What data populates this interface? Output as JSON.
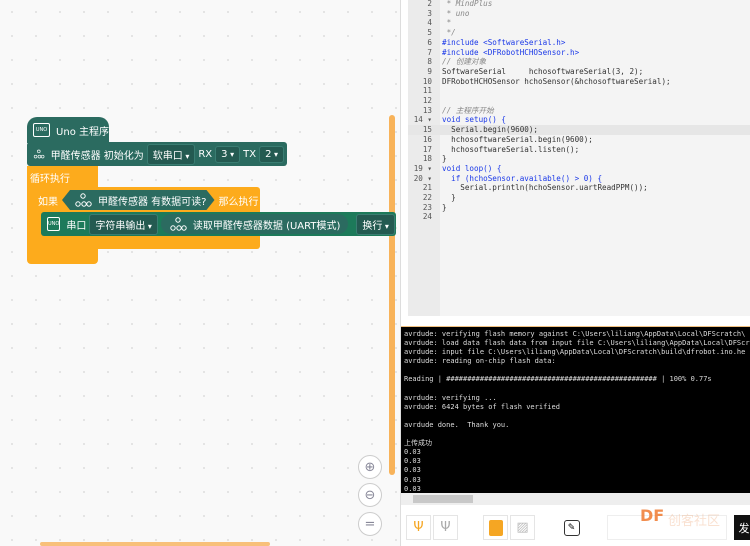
{
  "blocks": {
    "main_hat": "Uno 主程序",
    "uno_badge": "UNO",
    "init": {
      "label": "甲醛传感器 初始化为",
      "port": "软串口",
      "rx_label": "RX",
      "rx": "3",
      "tx_label": "TX",
      "tx": "2"
    },
    "loop": "循环执行",
    "if": {
      "label": "如果",
      "condition": "甲醛传感器 有数据可读?",
      "then": "那么执行"
    },
    "serial": {
      "label": "串口",
      "mode": "字符串输出",
      "reporter": "读取甲醛传感器数据 (UART模式)",
      "newline": "换行"
    }
  },
  "zoom_controls": {
    "zoom_in": "⊕",
    "zoom_out": "⊖",
    "reset": "="
  },
  "code": [
    {
      "n": "2",
      "t": " * MindPlus",
      "c": "cm"
    },
    {
      "n": "3",
      "t": " * uno",
      "c": "cm"
    },
    {
      "n": "4",
      "t": " *",
      "c": "cm"
    },
    {
      "n": "5",
      "t": " */",
      "c": "cm"
    },
    {
      "n": "6",
      "t": "#include <SoftwareSerial.h>",
      "c": "kw"
    },
    {
      "n": "7",
      "t": "#include <DFRobotHCHOSensor.h>",
      "c": "kw"
    },
    {
      "n": "8",
      "t": "// 创建对象",
      "c": "cm"
    },
    {
      "n": "9",
      "t": "SoftwareSerial     hchosoftwareSerial(3, 2);",
      "c": "tx"
    },
    {
      "n": "10",
      "t": "DFRobotHCHOSensor hchoSensor(&hchosoftwareSerial);",
      "c": "tx"
    },
    {
      "n": "11",
      "t": "",
      "c": "tx"
    },
    {
      "n": "12",
      "t": "",
      "c": "tx"
    },
    {
      "n": "13",
      "t": "// 主程序开始",
      "c": "cm"
    },
    {
      "n": "14 ▾",
      "t": "void setup() {",
      "c": "kw"
    },
    {
      "n": "15",
      "t": "  Serial.begin(9600);",
      "c": "tx"
    },
    {
      "n": "16",
      "t": "  hchosoftwareSerial.begin(9600);",
      "c": "tx"
    },
    {
      "n": "17",
      "t": "  hchosoftwareSerial.listen();",
      "c": "tx"
    },
    {
      "n": "18",
      "t": "}",
      "c": "tx"
    },
    {
      "n": "19 ▾",
      "t": "void loop() {",
      "c": "kw"
    },
    {
      "n": "20 ▾",
      "t": "  if (hchoSensor.available() > 0) {",
      "c": "kw"
    },
    {
      "n": "21",
      "t": "    Serial.println(hchoSensor.uartReadPPM());",
      "c": "tx"
    },
    {
      "n": "22",
      "t": "  }",
      "c": "tx"
    },
    {
      "n": "23",
      "t": "}",
      "c": "tx"
    },
    {
      "n": "24",
      "t": "",
      "c": "tx"
    }
  ],
  "terminal": "avrdude: verifying flash memory against C:\\Users\\liliang\\AppData\\Local\\DFScratch\\\navrdude: load data flash data from input file C:\\Users\\liliang\\AppData\\Local\\DFScratch\navrdude: input file C:\\Users\\liliang\\AppData\\Local\\DFScratch\\build\\dfrobot.ino.he\navrdude: reading on-chip flash data:\n\nReading | ################################################## | 100% 0.77s\n\navrdude: verifying ...\navrdude: 6424 bytes of flash verified\n\navrdude done.  Thank you.\n\n上传成功\n0.03\n0.03\n0.03\n0.03\n0.03",
  "toolbar": {
    "send": "发"
  },
  "watermark": "DF创客社区",
  "colors": {
    "block_teal": "#2b6b60",
    "control_orange": "#fdab1c",
    "terminal_bg": "#000000",
    "keyword": "#1a38e8"
  }
}
